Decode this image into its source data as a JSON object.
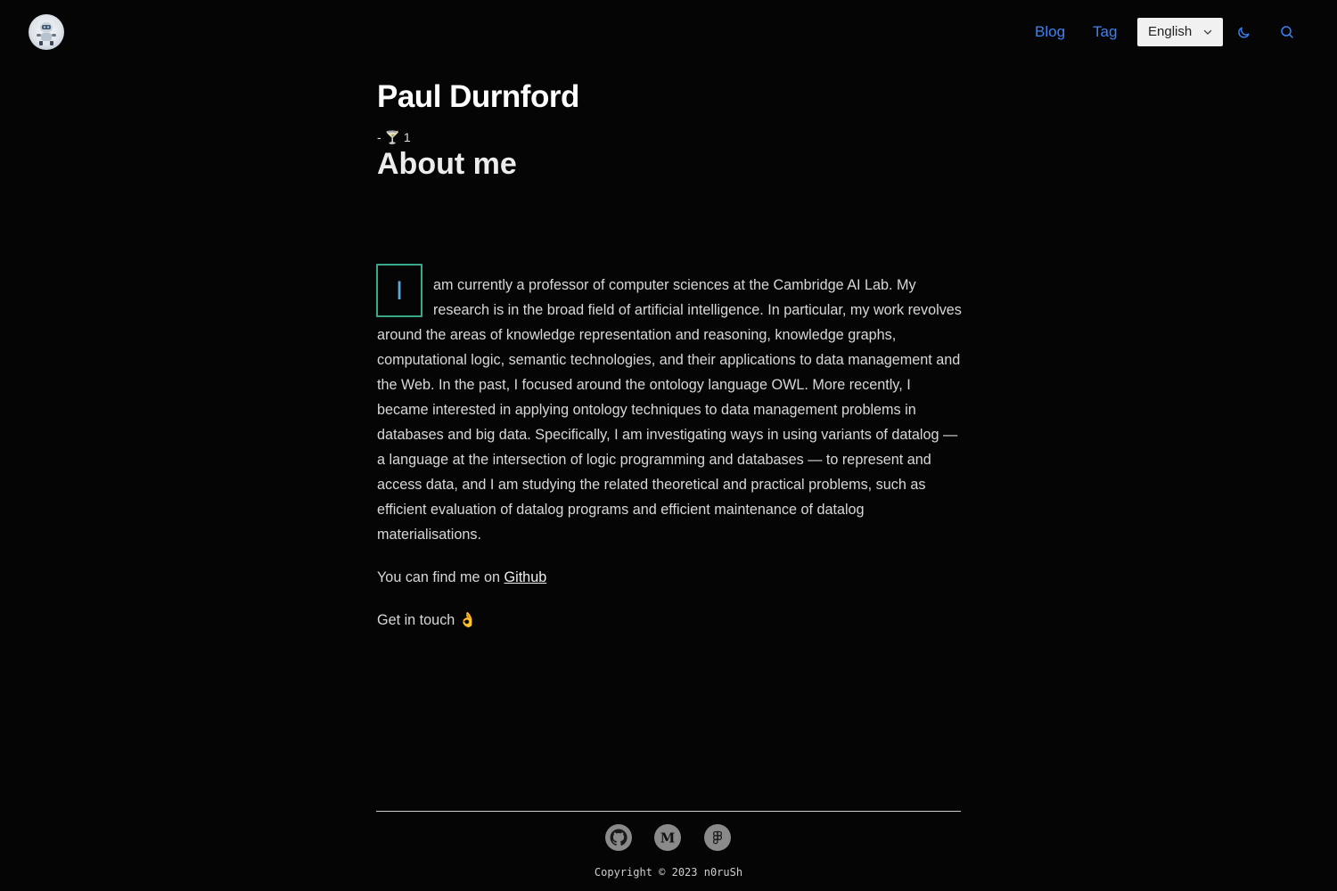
{
  "header": {
    "avatar_alt": "avatar",
    "nav": [
      {
        "label": "Blog"
      },
      {
        "label": "Tag"
      }
    ],
    "language": {
      "selected": "English"
    },
    "icons": {
      "theme": "moon-icon",
      "search": "search-icon",
      "language_dropdown": "chevron-down-icon"
    }
  },
  "main": {
    "title": "Paul Durnford",
    "meta": {
      "prefix": "-",
      "icon": "🍸",
      "count": "1"
    },
    "subtitle": "About me",
    "dropcap": "I",
    "paragraph": "am currently a professor of computer sciences at the Cambridge AI Lab. My research is in the broad field of artificial intelligence. In particular, my work revolves around the areas of knowledge representation and reasoning, knowledge graphs, computational logic, semantic technologies, and their applications to data management and the Web. In the past, I focused around the ontology language OWL. More recently, I became interested in applying ontology techniques to data management problems in databases and big data. Specifically, I am investigating ways in using variants of datalog — a language at the intersection of logic programming and databases — to represent and access data, and I am studying the related theoretical and practical problems, such as efficient evaluation of datalog programs and efficient maintenance of datalog materialisations.",
    "find_me": {
      "text": "You can find me on",
      "link": "Github"
    },
    "get_in_touch": {
      "text": "Get in touch",
      "emoji": "👌"
    }
  },
  "footer": {
    "social": [
      "github-icon",
      "medium-icon",
      "figma-icon"
    ],
    "copyright": "Copyright © 2023 n0ruSh"
  },
  "colors": {
    "background": "#050505",
    "link": "#3b82f6",
    "dropcap_border": "#3aa88a",
    "dropcap_text": "#5aa7d8",
    "social_bg": "#8a8a8a"
  }
}
